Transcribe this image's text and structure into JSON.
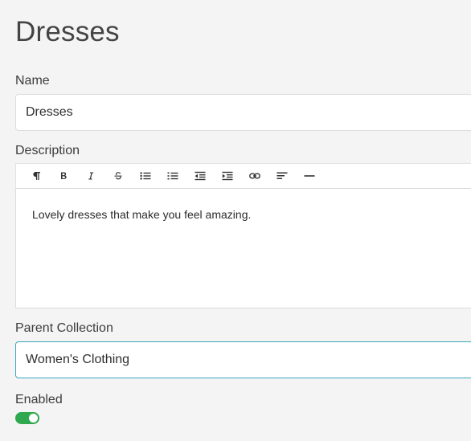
{
  "page": {
    "title": "Dresses"
  },
  "name_field": {
    "label": "Name",
    "value": "Dresses"
  },
  "description_field": {
    "label": "Description",
    "toolbar": [
      {
        "icon": "paragraph-icon"
      },
      {
        "icon": "bold-icon"
      },
      {
        "icon": "italic-icon"
      },
      {
        "icon": "strikethrough-icon"
      },
      {
        "icon": "bullet-list-icon"
      },
      {
        "icon": "numbered-list-icon"
      },
      {
        "icon": "outdent-icon"
      },
      {
        "icon": "indent-icon"
      },
      {
        "icon": "link-icon"
      },
      {
        "icon": "align-left-icon"
      },
      {
        "icon": "horizontal-rule-icon"
      }
    ],
    "content": "Lovely dresses that make you feel amazing."
  },
  "parent_collection_field": {
    "label": "Parent Collection",
    "value": "Women's Clothing"
  },
  "enabled_field": {
    "label": "Enabled",
    "value": true
  },
  "colors": {
    "toggle_on": "#2fa84f",
    "focus_border": "#3aa7b8"
  }
}
